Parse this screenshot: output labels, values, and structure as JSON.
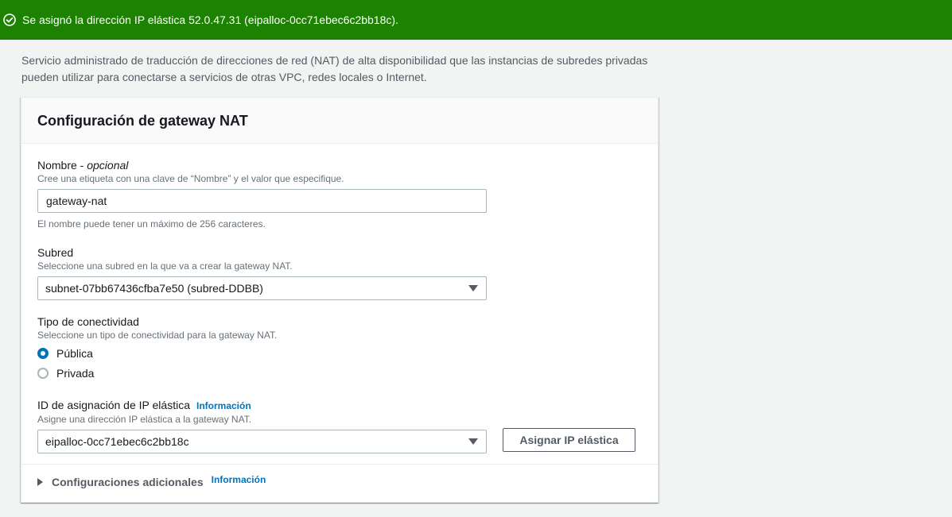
{
  "banner": {
    "message": "Se asignó la dirección IP elástica 52.0.47.31 (eipalloc-0cc71ebec6c2bb18c).",
    "color": "#1d8102"
  },
  "description": "Servicio administrado de traducción de direcciones de red (NAT) de alta disponibilidad que las instancias de subredes privadas pueden utilizar para conectarse a servicios de otras VPC, redes locales o Internet.",
  "panel": {
    "title": "Configuración de gateway NAT"
  },
  "name_field": {
    "label": "Nombre - ",
    "label_optional": "opcional",
    "description": "Cree una etiqueta con una clave de “Nombre” y el valor que especifique.",
    "value": "gateway-nat",
    "constraint": "El nombre puede tener un máximo de 256 caracteres."
  },
  "subnet_field": {
    "label": "Subred",
    "description": "Seleccione una subred en la que va a crear la gateway NAT.",
    "selected": "subnet-07bb67436cfba7e50 (subred-DDBB)"
  },
  "connectivity_field": {
    "label": "Tipo de conectividad",
    "description": "Seleccione un tipo de conectividad para la gateway NAT.",
    "options": [
      {
        "label": "Pública",
        "checked": true
      },
      {
        "label": "Privada",
        "checked": false
      }
    ]
  },
  "eip_field": {
    "label": "ID de asignación de IP elástica",
    "info": "Información",
    "description": "Asigne una dirección IP elástica a la gateway NAT.",
    "selected": "eipalloc-0cc71ebec6c2bb18c",
    "button_label": "Asignar IP elástica"
  },
  "additional": {
    "label": "Configuraciones adicionales",
    "info": "Información"
  },
  "colors": {
    "link": "#0073bb",
    "radio_selected": "#0073bb"
  }
}
